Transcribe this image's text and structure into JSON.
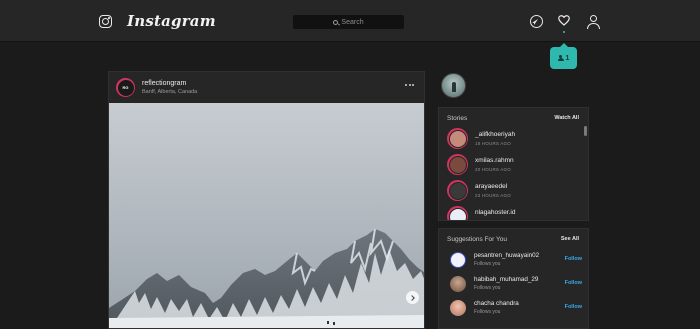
{
  "header": {
    "wordmark": "Instagram",
    "search_placeholder": "Search"
  },
  "notification": {
    "count": "1"
  },
  "post": {
    "username": "reflectiongram",
    "location": "Banff, Alberta, Canada"
  },
  "stories": {
    "title": "Stories",
    "link": "Watch All",
    "items": [
      {
        "name": "_alifkhoeriyah",
        "time": "18 HOURS AGO",
        "color": "#c58b7a"
      },
      {
        "name": "xmilas.rahmn",
        "time": "20 HOURS AGO",
        "color": "#7a4a3e"
      },
      {
        "name": "arayaeedel",
        "time": "23 HOURS AGO",
        "color": "#3a3a3a"
      },
      {
        "name": "nlagahoster.id",
        "time": "",
        "color": "#2f7bd6"
      }
    ]
  },
  "suggestions": {
    "title": "Suggestions For You",
    "link": "See All",
    "follow_label": "Follow",
    "items": [
      {
        "name": "pesantren_huwayain02",
        "sub": "Follows you",
        "color": "#3f4fc2"
      },
      {
        "name": "habibah_muhamad_29",
        "sub": "Follows you",
        "color": "#8a6a55"
      },
      {
        "name": "chacha chandra",
        "sub": "Follows you",
        "color": "#d6a28d"
      }
    ]
  }
}
